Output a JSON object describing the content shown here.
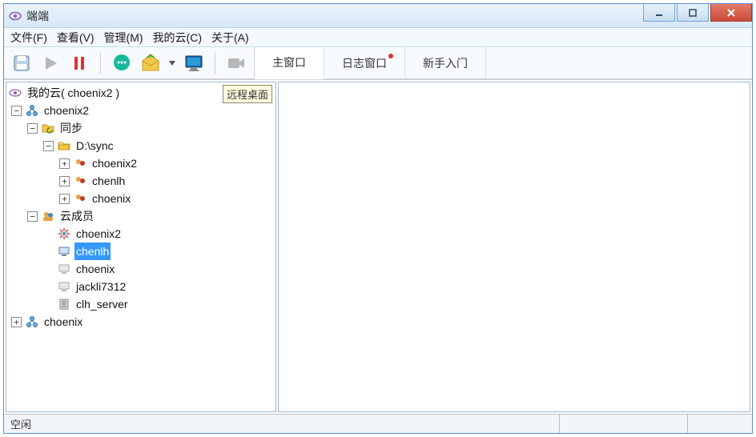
{
  "window": {
    "title": "端端"
  },
  "menu": {
    "file": "文件(F)",
    "view": "查看(V)",
    "manage": "管理(M)",
    "mycloud": "我的云(C)",
    "about": "关于(A)"
  },
  "tabs": {
    "main": "主窗口",
    "log": "日志窗口",
    "newbie": "新手入门"
  },
  "tooltip": {
    "remote_desktop": "远程桌面"
  },
  "tree": {
    "root": "我的云( choenix2 )",
    "host1": "choenix2",
    "sync": "同步",
    "sync_path": "D:\\sync",
    "sync_children": [
      "choenix2",
      "chenlh",
      "choenix"
    ],
    "members": "云成员",
    "member_list": [
      "choenix2",
      "chenlh",
      "choenix",
      "jackli7312",
      "clh_server"
    ],
    "host2": "choenix"
  },
  "status": {
    "idle": "空闲"
  },
  "icons": {
    "app": "eye",
    "save": "floppy",
    "play": "play",
    "pause": "pause",
    "chat": "chat-bubble",
    "mail": "envelope-open",
    "monitor": "monitor",
    "camera": "camera"
  },
  "colors": {
    "selection": "#3399ff",
    "titlebar_grad_top": "#eaf3fb",
    "titlebar_grad_bot": "#d7e8f7",
    "close_btn": "#c94a3a"
  }
}
